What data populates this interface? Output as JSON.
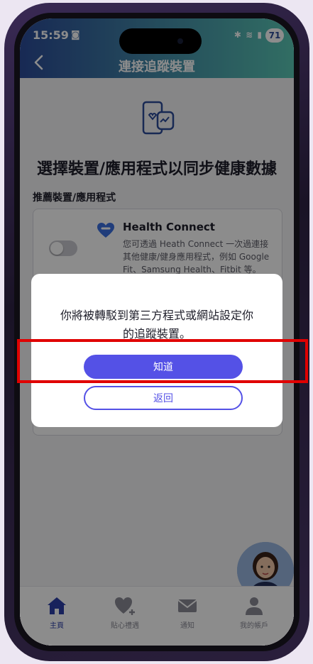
{
  "status_bar": {
    "time": "15:59",
    "battery": "71"
  },
  "header": {
    "title": "連接追蹤裝置"
  },
  "page": {
    "heading": "選擇裝置/應用程式以同步健康數據",
    "section_label": "推薦裝置/應用程式"
  },
  "health_connect": {
    "name": "Health Connect",
    "description": "您可透過 Heath Connect 一次過連接其他健康/健身應用程式，例如 Google Fit、Samsung Health、Fitbit 等。",
    "toggle_on": false
  },
  "dialog": {
    "message": "你將被轉駁到第三方程式或網站設定你的追蹤裝置。",
    "confirm_label": "知道",
    "back_label": "返回"
  },
  "tabbar": {
    "items": [
      {
        "label": "主頁",
        "icon": "home-icon",
        "active": true
      },
      {
        "label": "貼心禮遇",
        "icon": "heart-plus-icon",
        "active": false
      },
      {
        "label": "通知",
        "icon": "mail-icon",
        "active": false
      },
      {
        "label": "我的帳戶",
        "icon": "person-icon",
        "active": false
      }
    ]
  },
  "colors": {
    "accent": "#5451e6",
    "header_start": "#2c4c9a",
    "header_end": "#5ac8b5",
    "highlight": "#e00000"
  }
}
